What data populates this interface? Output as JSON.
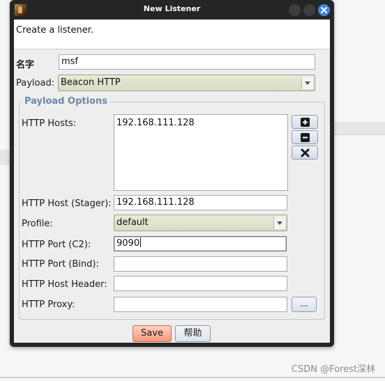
{
  "window": {
    "title": "New Listener"
  },
  "header": {
    "text": "Create a listener."
  },
  "form": {
    "name_label": "名字",
    "name_value": "msf",
    "payload_label": "Payload:",
    "payload_value": "Beacon HTTP"
  },
  "payload_options": {
    "title": "Payload Options",
    "http_hosts_label": "HTTP Hosts:",
    "http_hosts": [
      "192.168.111.128"
    ],
    "stager_label": "HTTP Host (Stager):",
    "stager_value": "192.168.111.128",
    "profile_label": "Profile:",
    "profile_value": "default",
    "port_c2_label": "HTTP Port (C2):",
    "port_c2_value": "9090",
    "port_bind_label": "HTTP Port (Bind):",
    "port_bind_value": "",
    "host_header_label": "HTTP Host Header:",
    "host_header_value": "",
    "proxy_label": "HTTP Proxy:",
    "proxy_value": "",
    "browse_label": "..."
  },
  "buttons": {
    "save_label": "Save",
    "help_label": "帮助"
  },
  "watermark": "CSDN @Forest深林",
  "icons": {
    "add": "plus-icon",
    "remove": "minus-icon",
    "clear": "x-icon",
    "dropdown": "chevron-down-icon",
    "window_close": "close-icon"
  },
  "colors": {
    "save_button": "#f5977b",
    "group_title": "#6a87a6",
    "combo_background": "#d9dcc4",
    "close_button": "#3d86e0"
  }
}
